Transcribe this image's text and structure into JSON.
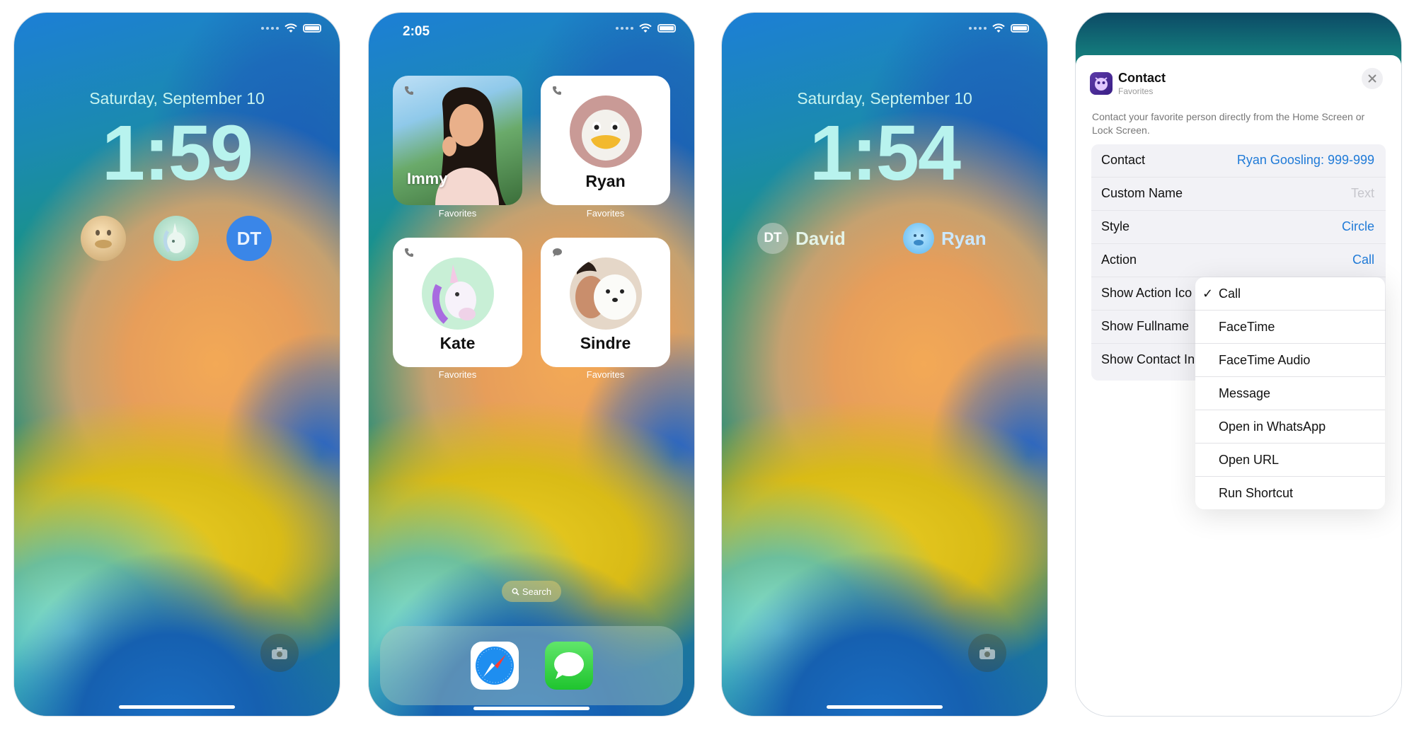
{
  "phone1": {
    "date": "Saturday, September 10",
    "time": "1:59",
    "widgets": [
      {
        "name": "duck-face"
      },
      {
        "name": "unicorn-face"
      },
      {
        "initials": "DT"
      }
    ]
  },
  "phone2": {
    "time": "2:05",
    "widgets": [
      {
        "name": "Immy",
        "caption": "Favorites"
      },
      {
        "name": "Ryan",
        "caption": "Favorites"
      },
      {
        "name": "Kate",
        "caption": "Favorites"
      },
      {
        "name": "Sindre",
        "caption": "Favorites"
      }
    ],
    "search": "Search"
  },
  "phone3": {
    "date": "Saturday, September 10",
    "time": "1:54",
    "contacts": [
      {
        "initials": "DT",
        "name": "David"
      },
      {
        "name": "Ryan"
      }
    ]
  },
  "phone4": {
    "app_title": "Contact",
    "app_subtitle": "Favorites",
    "description": "Contact your favorite person directly from the Home Screen or Lock Screen.",
    "rows": [
      {
        "label": "Contact",
        "value": "Ryan Goosling: 999-999"
      },
      {
        "label": "Custom Name",
        "placeholder": "Text"
      },
      {
        "label": "Style",
        "value": "Circle"
      },
      {
        "label": "Action",
        "value": "Call"
      },
      {
        "label": "Show Action Ico"
      },
      {
        "label": "Show Fullname"
      },
      {
        "label": "Show Contact In"
      }
    ],
    "menu": [
      {
        "label": "Call",
        "checked": "✓"
      },
      {
        "label": "FaceTime"
      },
      {
        "label": "FaceTime Audio"
      },
      {
        "label": "Message"
      },
      {
        "label": "Open in WhatsApp"
      },
      {
        "label": "Open URL"
      },
      {
        "label": "Run Shortcut"
      }
    ]
  }
}
